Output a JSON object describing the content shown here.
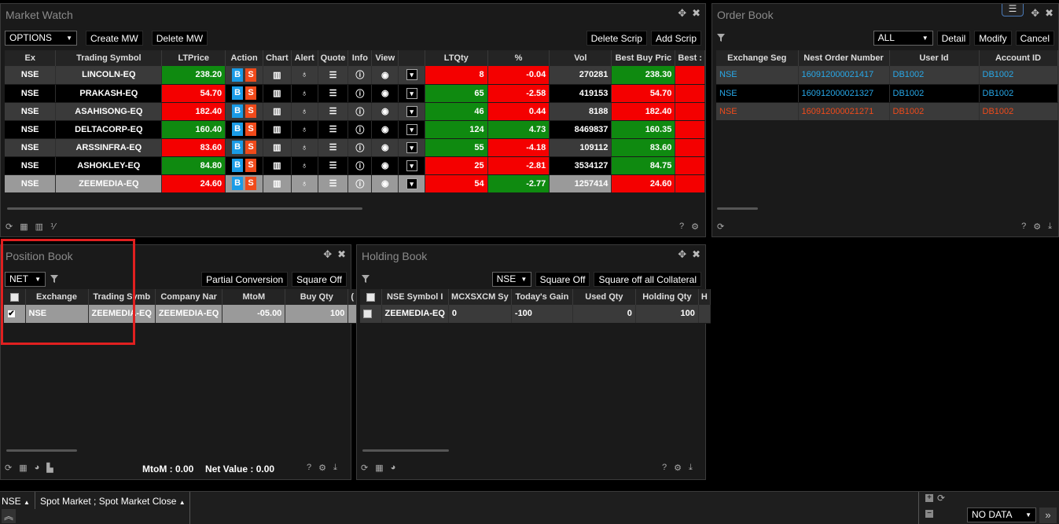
{
  "market_watch": {
    "title": "Market Watch",
    "segment": "OPTIONS",
    "create_mw": "Create MW",
    "delete_mw": "Delete MW",
    "delete_scrip": "Delete Scrip",
    "add_scrip": "Add Scrip",
    "columns": [
      "Ex",
      "Trading Symbol",
      "LTPrice",
      "Action",
      "Chart",
      "Alert",
      "Quote",
      "Info",
      "View",
      "",
      "LTQty",
      "%",
      "Vol",
      "Best Buy Pric",
      "Best :"
    ],
    "buy_label": "B",
    "sell_label": "S",
    "rows": [
      {
        "ex": "NSE",
        "symbol": "LINCOLN-EQ",
        "ltp": "238.20",
        "ltp_dir": "up",
        "ltqty": "8",
        "ltqty_dir": "down",
        "pct": "-0.04",
        "pct_dir": "down",
        "vol": "270281",
        "best_buy": "238.30",
        "best_buy_dir": "up"
      },
      {
        "ex": "NSE",
        "symbol": "PRAKASH-EQ",
        "ltp": "54.70",
        "ltp_dir": "down",
        "ltqty": "65",
        "ltqty_dir": "up",
        "pct": "-2.58",
        "pct_dir": "down",
        "vol": "419153",
        "best_buy": "54.70",
        "best_buy_dir": "down"
      },
      {
        "ex": "NSE",
        "symbol": "ASAHISONG-EQ",
        "ltp": "182.40",
        "ltp_dir": "down",
        "ltqty": "46",
        "ltqty_dir": "up",
        "pct": "0.44",
        "pct_dir": "down",
        "vol": "8188",
        "best_buy": "182.40",
        "best_buy_dir": "down"
      },
      {
        "ex": "NSE",
        "symbol": "DELTACORP-EQ",
        "ltp": "160.40",
        "ltp_dir": "up",
        "ltqty": "124",
        "ltqty_dir": "up",
        "pct": "4.73",
        "pct_dir": "up",
        "vol": "8469837",
        "best_buy": "160.35",
        "best_buy_dir": "up"
      },
      {
        "ex": "NSE",
        "symbol": "ARSSINFRA-EQ",
        "ltp": "83.60",
        "ltp_dir": "down",
        "ltqty": "55",
        "ltqty_dir": "up",
        "pct": "-4.18",
        "pct_dir": "down",
        "vol": "109112",
        "best_buy": "83.60",
        "best_buy_dir": "up"
      },
      {
        "ex": "NSE",
        "symbol": "ASHOKLEY-EQ",
        "ltp": "84.80",
        "ltp_dir": "up",
        "ltqty": "25",
        "ltqty_dir": "down",
        "pct": "-2.81",
        "pct_dir": "down",
        "vol": "3534127",
        "best_buy": "84.75",
        "best_buy_dir": "up"
      },
      {
        "ex": "NSE",
        "symbol": "ZEEMEDIA-EQ",
        "ltp": "24.60",
        "ltp_dir": "down",
        "ltqty": "54",
        "ltqty_dir": "down",
        "pct": "-2.77",
        "pct_dir": "up",
        "vol": "1257414",
        "best_buy": "24.60",
        "best_buy_dir": "down"
      }
    ]
  },
  "order_book": {
    "title": "Order Book",
    "status_filter": "ALL",
    "detail": "Detail",
    "modify": "Modify",
    "cancel": "Cancel",
    "columns": [
      "Exchange Seg",
      "Nest Order Number",
      "User Id",
      "Account ID"
    ],
    "rows": [
      {
        "seg": "NSE",
        "order": "160912000021417",
        "user": "DB1002",
        "account": "DB1002",
        "status": "blue"
      },
      {
        "seg": "NSE",
        "order": "160912000021327",
        "user": "DB1002",
        "account": "DB1002",
        "status": "blue"
      },
      {
        "seg": "NSE",
        "order": "160912000021271",
        "user": "DB1002",
        "account": "DB1002",
        "status": "red"
      }
    ]
  },
  "position_book": {
    "title": "Position Book",
    "type": "NET",
    "partial_conversion": "Partial Conversion",
    "square_off": "Square Off",
    "columns": [
      "Exchange",
      "Trading Symb",
      "Company Nar",
      "MtoM",
      "Buy Qty",
      "("
    ],
    "rows": [
      {
        "exchange": "NSE",
        "symbol": "ZEEMEDIA-EQ",
        "company": "ZEEMEDIA-EQ",
        "mtom": "-05.00",
        "buy_qty": "100"
      }
    ],
    "mtom_total": "MtoM : 0.00",
    "net_value": "Net Value : 0.00"
  },
  "holding_book": {
    "title": "Holding Book",
    "exchange": "NSE",
    "square_off": "Square Off",
    "square_off_all": "Square off all Collateral",
    "columns": [
      "NSE Symbol I",
      "MCXSXCM Sy",
      "Today's Gain",
      "Used Qty",
      "Holding Qty",
      "H"
    ],
    "rows": [
      {
        "nse_symbol": "ZEEMEDIA-EQ",
        "mcx": "0",
        "gain": "-100",
        "used": "0",
        "holding": "100"
      }
    ]
  },
  "statusbar": {
    "exchange": "NSE",
    "market": "Spot Market ; Spot Market Close",
    "no_data": "NO DATA"
  }
}
